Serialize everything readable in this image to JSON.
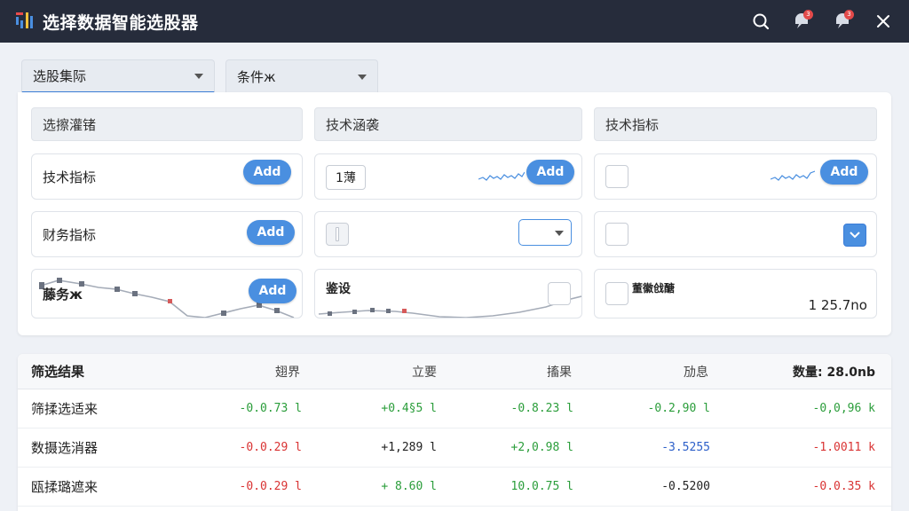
{
  "app": {
    "title": "选择数据智能选股器"
  },
  "titlebar": {
    "badges": [
      "3",
      "3"
    ]
  },
  "dropdowns": [
    {
      "label": "选股集际"
    },
    {
      "label": "条件ж"
    }
  ],
  "columns": [
    {
      "header": "选擦灌锗"
    },
    {
      "header": "技术涵袭"
    },
    {
      "header": "技术指标"
    }
  ],
  "cards": {
    "c1r1": {
      "label": "技术指标",
      "button": "Add"
    },
    "c1r2": {
      "label": "财务指标",
      "button": "Add"
    },
    "c1r3": {
      "label": "藤务ж",
      "button": "Add"
    },
    "c2r1": {
      "value": "1薄",
      "button": "Add"
    },
    "c2r3": {
      "label": "鉴设"
    },
    "c3r1": {
      "button": "Add"
    },
    "c3r3": {
      "label": "董徽戗醣",
      "readout": "1 25.7no"
    }
  },
  "results": {
    "title": "筛选结果",
    "columns": [
      "翅界",
      "立要",
      "搐果",
      "劢息",
      "数量: 28.0nb"
    ],
    "rows": [
      {
        "name": "筛揉选适来",
        "values": [
          "-0.0.73 l",
          "+0.4§5 l",
          "-0.8.23 l",
          "-0.2,90 l",
          "-0,0,96  k"
        ],
        "colors": [
          "pos",
          "pos",
          "pos",
          "pos",
          "pos"
        ]
      },
      {
        "name": "数摄选消器",
        "values": [
          "-0.0.29 l",
          "+1,289 l",
          "+2,0.98 l",
          "-3.5255",
          "-1.0011 k"
        ],
        "colors": [
          "neg",
          "neutral",
          "pos",
          "blue",
          "neg"
        ]
      },
      {
        "name": "瓯揉璐遮来",
        "values": [
          "-0.0.29 l",
          "+ 8.60 l",
          "10.0.75 l",
          "-0.5200",
          "-0.0.35 k"
        ],
        "colors": [
          "neg",
          "pos",
          "pos",
          "neutral",
          "neg"
        ]
      }
    ]
  },
  "colors": {
    "titlebar": "#262c3b",
    "accent": "#4a8fe0",
    "positive": "#2a9d3a",
    "negative": "#d93333"
  },
  "icons": [
    "logo-icon",
    "search-icon",
    "notification-icon",
    "message-icon",
    "close-icon",
    "chevron-down-icon",
    "check-icon"
  ]
}
